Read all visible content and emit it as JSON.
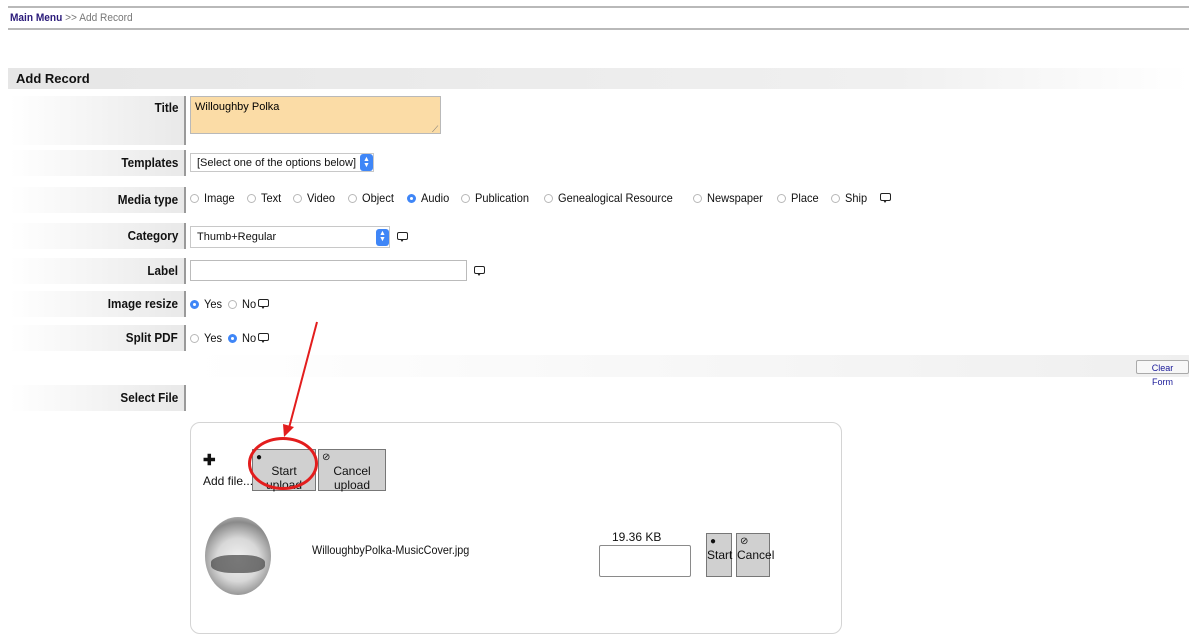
{
  "breadcrumb": {
    "main": "Main Menu",
    "sep": ">>",
    "current": "Add Record"
  },
  "section": {
    "title": "Add Record"
  },
  "form": {
    "title": {
      "label": "Title",
      "value": "Willoughby Polka"
    },
    "templates": {
      "label": "Templates",
      "value": "[Select one of the options below]"
    },
    "media_type": {
      "label": "Media type",
      "options": [
        "Image",
        "Text",
        "Video",
        "Object",
        "Audio",
        "Publication",
        "Genealogical Resource",
        "Newspaper",
        "Place",
        "Ship"
      ],
      "selected": "Audio"
    },
    "category": {
      "label": "Category",
      "value": "Thumb+Regular"
    },
    "label_field": {
      "label": "Label",
      "value": ""
    },
    "image_resize": {
      "label": "Image resize",
      "yes": "Yes",
      "no": "No",
      "selected": "Yes"
    },
    "split_pdf": {
      "label": "Split PDF",
      "yes": "Yes",
      "no": "No",
      "selected": "No"
    },
    "clear_form": "Clear Form",
    "select_file": {
      "label": "Select File"
    }
  },
  "uploader": {
    "add_file": "Add file...",
    "start_upload": "Start upload",
    "cancel_upload": "Cancel upload",
    "file": {
      "name": "WilloughbyPolka-MusicCover.jpg",
      "size": "19.36 KB",
      "start": "Start",
      "cancel": "Cancel"
    }
  },
  "colors": {
    "title_bg": "#fbdca6",
    "radio_on": "#3f86f7",
    "annotation": "#e31d1d",
    "link": "#2a1a7a"
  },
  "icons": {
    "info": "speech-bubble-icon",
    "add": "plus-icon",
    "start": "arrow-circle-icon",
    "cancel": "no-entry-icon"
  }
}
